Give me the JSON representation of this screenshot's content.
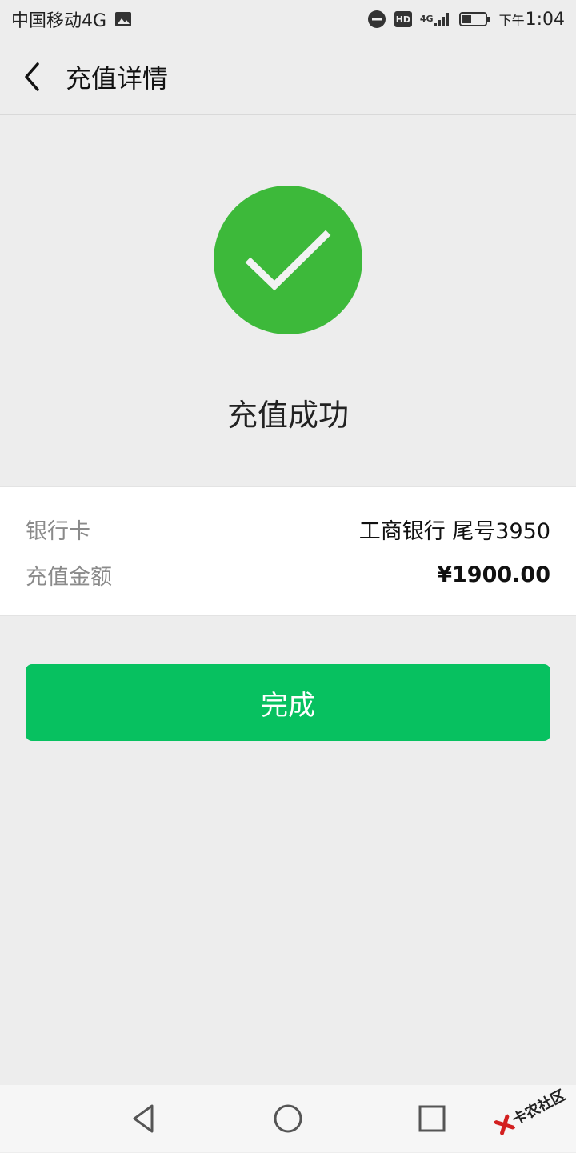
{
  "status_bar": {
    "carrier": "中国移动4G",
    "hd_label": "HD",
    "network_label": "4G",
    "time_prefix": "下午",
    "time": "1:04"
  },
  "nav": {
    "title": "充值详情"
  },
  "result": {
    "message": "充值成功",
    "accent_color": "#3db93a"
  },
  "details": {
    "bank_label": "银行卡",
    "bank_value": "工商银行 尾号3950",
    "amount_label": "充值金额",
    "amount_value": "¥1900.00"
  },
  "actions": {
    "done_label": "完成",
    "done_color": "#07c160"
  },
  "watermark": {
    "text": "卡农社区"
  }
}
